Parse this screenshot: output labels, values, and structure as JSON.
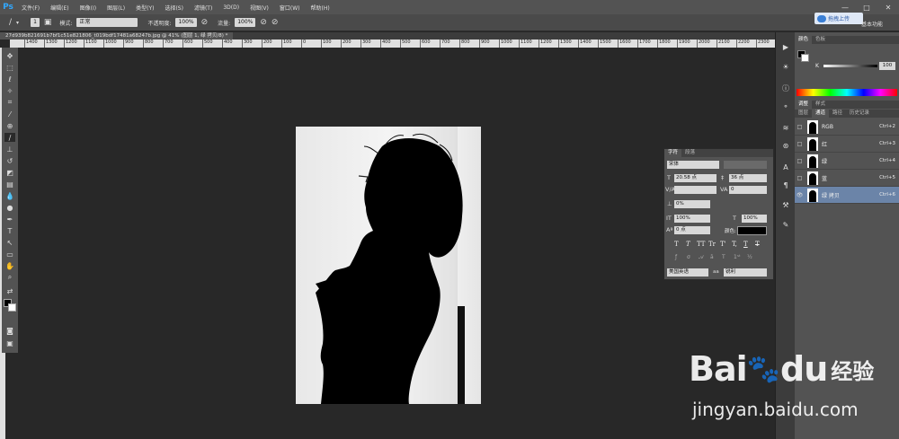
{
  "app": {
    "logo": "Ps"
  },
  "menu": [
    "文件(F)",
    "编辑(E)",
    "图像(I)",
    "图层(L)",
    "类型(Y)",
    "选择(S)",
    "滤镜(T)",
    "3D(D)",
    "视图(V)",
    "窗口(W)",
    "帮助(H)"
  ],
  "window_controls": [
    "—",
    "□",
    "✕"
  ],
  "options_bar": {
    "brush_size": "1",
    "mode_label": "模式:",
    "mode_value": "正常",
    "opacity_label": "不透明度:",
    "opacity_value": "100%",
    "flow_label": "流量:",
    "flow_value": "100%"
  },
  "upload_button": "拖拽上传",
  "workspace": "基本功能",
  "document_tab": "27d939b821691b7bf1c51e821806_t019bdf17481a68247b.jpg @ 41% (图层 1, 绿 拷贝/8) *",
  "ruler_ticks": [
    "1400",
    "1300",
    "1200",
    "1100",
    "1000",
    "900",
    "800",
    "700",
    "600",
    "500",
    "400",
    "300",
    "200",
    "100",
    "0",
    "100",
    "200",
    "300",
    "400",
    "500",
    "600",
    "700",
    "800",
    "900",
    "1000",
    "1100",
    "1200",
    "1300",
    "1400",
    "1500",
    "1600",
    "1700",
    "1800",
    "1900",
    "2000",
    "2100",
    "2200",
    "2300"
  ],
  "color_panel": {
    "tabs": [
      "颜色",
      "色板"
    ],
    "channel_label": "K",
    "value": "100"
  },
  "adjust_tabs": [
    "调整",
    "样式"
  ],
  "layer_tabs": [
    "图层",
    "通道",
    "路径",
    "历史记录"
  ],
  "channels": [
    {
      "name": "RGB",
      "shortcut": "Ctrl+2"
    },
    {
      "name": "红",
      "shortcut": "Ctrl+3"
    },
    {
      "name": "绿",
      "shortcut": "Ctrl+4"
    },
    {
      "name": "蓝",
      "shortcut": "Ctrl+5"
    },
    {
      "name": "绿 拷贝",
      "shortcut": "Ctrl+6"
    }
  ],
  "character_panel": {
    "tabs": [
      "字符",
      "段落"
    ],
    "font_family": "宋体",
    "font_size": "20.58 点",
    "leading": "36 点",
    "kerning": "",
    "tracking": "0",
    "scale_pct": "0%",
    "vscale": "100%",
    "hscale": "100%",
    "baseline": "0 点",
    "color_label": "颜色:",
    "language": "美国英语",
    "aa_label": "aa",
    "aa_value": "锐利",
    "styles": [
      "T",
      "T",
      "TT",
      "Tr",
      "T'",
      "T,",
      "T",
      "T"
    ]
  },
  "watermark": {
    "brand": "Bai",
    "brand2": "du",
    "cn": "经验",
    "url": "jingyan.baidu.com"
  },
  "colors": {
    "panel": "#535353",
    "accent": "#31a8ff",
    "selected_row": "#6b84a8"
  }
}
